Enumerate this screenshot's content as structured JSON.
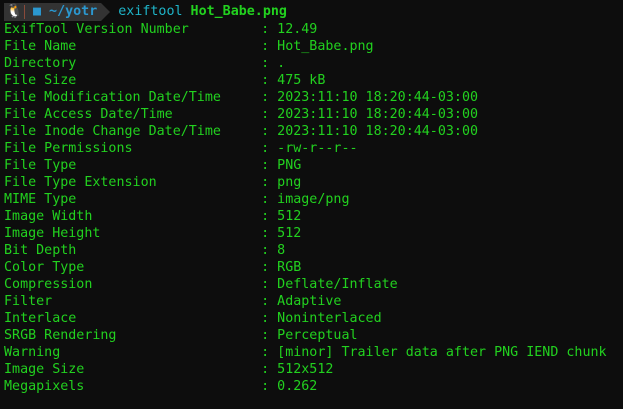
{
  "prompt": {
    "os_icon": "linux-tux-icon",
    "folder_icon": "folder-icon",
    "cwd": "~/yotr",
    "command": "exiftool",
    "argument": "Hot_Babe.png"
  },
  "colors": {
    "background": "#0d0d0d",
    "output_text": "#22d11f",
    "prompt_blue": "#2b98d0",
    "command": "#1eb4c8"
  },
  "separator": ": ",
  "output": [
    {
      "key": "ExifTool Version Number",
      "value": "12.49"
    },
    {
      "key": "File Name",
      "value": "Hot_Babe.png"
    },
    {
      "key": "Directory",
      "value": "."
    },
    {
      "key": "File Size",
      "value": "475 kB"
    },
    {
      "key": "File Modification Date/Time",
      "value": "2023:11:10 18:20:44-03:00"
    },
    {
      "key": "File Access Date/Time",
      "value": "2023:11:10 18:20:44-03:00"
    },
    {
      "key": "File Inode Change Date/Time",
      "value": "2023:11:10 18:20:44-03:00"
    },
    {
      "key": "File Permissions",
      "value": "-rw-r--r--"
    },
    {
      "key": "File Type",
      "value": "PNG"
    },
    {
      "key": "File Type Extension",
      "value": "png"
    },
    {
      "key": "MIME Type",
      "value": "image/png"
    },
    {
      "key": "Image Width",
      "value": "512"
    },
    {
      "key": "Image Height",
      "value": "512"
    },
    {
      "key": "Bit Depth",
      "value": "8"
    },
    {
      "key": "Color Type",
      "value": "RGB"
    },
    {
      "key": "Compression",
      "value": "Deflate/Inflate"
    },
    {
      "key": "Filter",
      "value": "Adaptive"
    },
    {
      "key": "Interlace",
      "value": "Noninterlaced"
    },
    {
      "key": "SRGB Rendering",
      "value": "Perceptual"
    },
    {
      "key": "Warning",
      "value": "[minor] Trailer data after PNG IEND chunk"
    },
    {
      "key": "Image Size",
      "value": "512x512"
    },
    {
      "key": "Megapixels",
      "value": "0.262"
    }
  ]
}
